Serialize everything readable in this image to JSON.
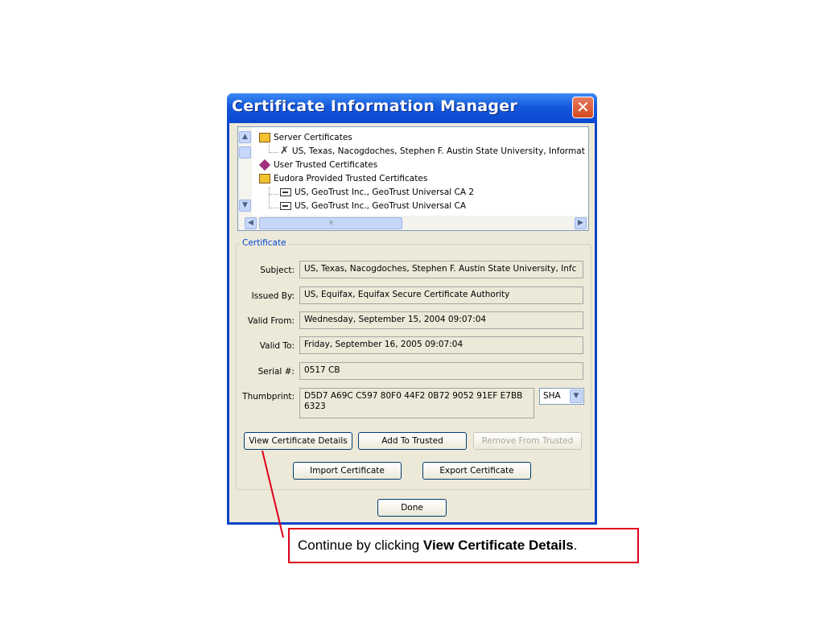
{
  "dialog": {
    "title": "Certificate Information Manager",
    "close_glyph": "✕"
  },
  "tree": {
    "items": [
      {
        "label": "Server Certificates",
        "icon": "book-icon"
      },
      {
        "label": "US, Texas, Nacogdoches, Stephen F. Austin State University, Informat",
        "icon": "broken-certificate-icon"
      },
      {
        "label": "User Trusted Certificates",
        "icon": "diamond-icon"
      },
      {
        "label": "Eudora Provided Trusted Certificates",
        "icon": "book-icon"
      },
      {
        "label": "US, GeoTrust Inc., GeoTrust Universal CA 2",
        "icon": "certificate-icon"
      },
      {
        "label": "US, GeoTrust Inc., GeoTrust Universal CA",
        "icon": "certificate-icon"
      }
    ],
    "hthumb_grip": "IIII"
  },
  "certificate": {
    "group_label": "Certificate",
    "subject_label": "Subject:",
    "subject_value": "US, Texas, Nacogdoches, Stephen F. Austin State University, Infc",
    "issued_by_label": "Issued By:",
    "issued_by_value": "US, Equifax, Equifax Secure Certificate Authority",
    "valid_from_label": "Valid From:",
    "valid_from_value": "Wednesday, September 15, 2004 09:07:04",
    "valid_to_label": "Valid To:",
    "valid_to_value": "Friday, September 16, 2005 09:07:04",
    "serial_label": "Serial #:",
    "serial_value": "0517 CB",
    "thumbprint_label": "Thumbprint:",
    "thumbprint_line1": "D5D7 A69C C597 80F0 44F2 0B72 9052 91EF E7BB",
    "thumbprint_line2": "6323",
    "hash_algorithm": "SHA"
  },
  "buttons": {
    "view_details": "View Certificate Details",
    "add_trusted": "Add To Trusted",
    "remove_trusted": "Remove From Trusted",
    "import": "Import Certificate",
    "export": "Export Certificate",
    "done": "Done"
  },
  "callout": {
    "prefix": "Continue by clicking ",
    "emphasis": "View Certificate Details",
    "suffix": "."
  }
}
